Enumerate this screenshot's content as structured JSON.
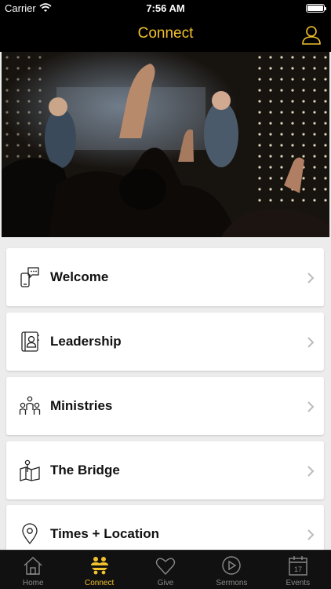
{
  "status": {
    "carrier": "Carrier",
    "time": "7:56 AM",
    "battery_level": 1.0
  },
  "nav": {
    "title": "Connect"
  },
  "items": [
    {
      "label": "Welcome",
      "icon": "phone-chat-icon"
    },
    {
      "label": "Leadership",
      "icon": "contact-book-icon"
    },
    {
      "label": "Ministries",
      "icon": "people-group-icon"
    },
    {
      "label": "The Bridge",
      "icon": "map-pin-icon"
    },
    {
      "label": "Times + Location",
      "icon": "location-pin-icon"
    }
  ],
  "tabs": [
    {
      "label": "Home",
      "icon": "home-icon",
      "active": false
    },
    {
      "label": "Connect",
      "icon": "connect-icon",
      "active": true
    },
    {
      "label": "Give",
      "icon": "heart-icon",
      "active": false
    },
    {
      "label": "Sermons",
      "icon": "play-icon",
      "active": false
    },
    {
      "label": "Events",
      "icon": "calendar-icon",
      "active": false,
      "calendar_day": "17"
    }
  ],
  "colors": {
    "accent": "#f2c12e",
    "background": "#ececec",
    "bar": "#000000",
    "inactive_tab": "#8a8a8a"
  }
}
